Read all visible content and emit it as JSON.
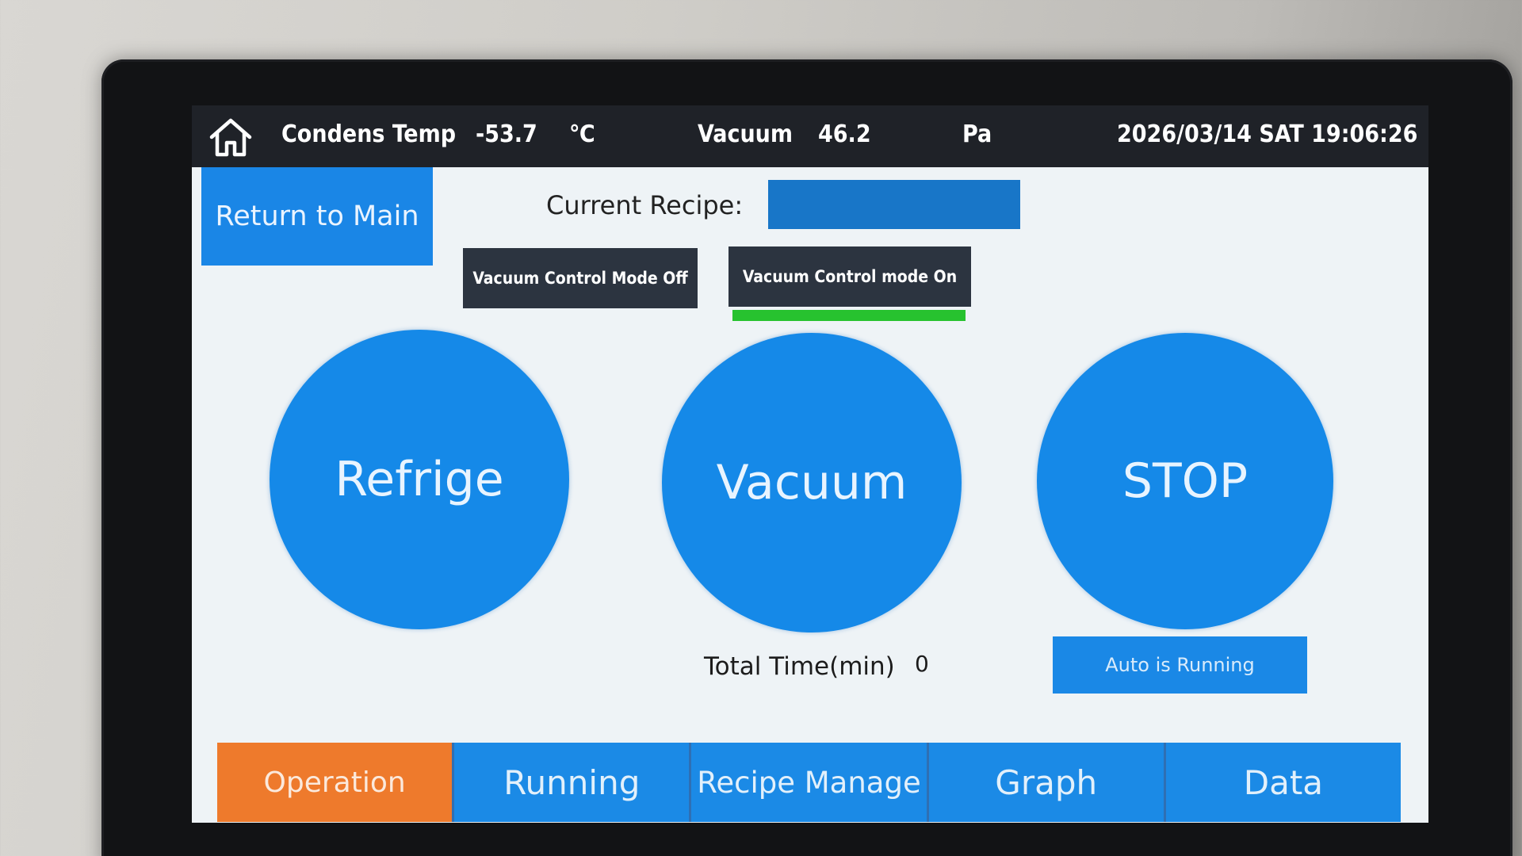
{
  "status_bar": {
    "condens_label": "Condens Temp",
    "condens_value": "-53.7",
    "condens_unit": "℃",
    "vacuum_label": "Vacuum",
    "vacuum_value": "46.2",
    "vacuum_unit": "Pa",
    "datetime": "2026/03/14 SAT 19:06:26",
    "home_icon": "home-icon"
  },
  "main": {
    "return_label": "Return to Main",
    "recipe_label": "Current Recipe:",
    "recipe_value": "",
    "mode_off_label": "Vacuum Control Mode Off",
    "mode_on_label": "Vacuum Control mode On",
    "mode_on_active": true,
    "refrige_label": "Refrige",
    "vacuum_label": "Vacuum",
    "stop_label": "STOP",
    "total_time_label": "Total Time(min)",
    "total_time_value": "0",
    "auto_status": "Auto is Running"
  },
  "nav": {
    "tabs": [
      {
        "label": "Operation",
        "active": true
      },
      {
        "label": "Running",
        "active": false
      },
      {
        "label": "Recipe Manage",
        "active": false
      },
      {
        "label": "Graph",
        "active": false
      },
      {
        "label": "Data",
        "active": false
      }
    ]
  },
  "colors": {
    "accent_blue": "#1589e8",
    "active_tab": "#ee7a2c",
    "indicator_green": "#27c22f",
    "status_bar": "#1f2228"
  }
}
